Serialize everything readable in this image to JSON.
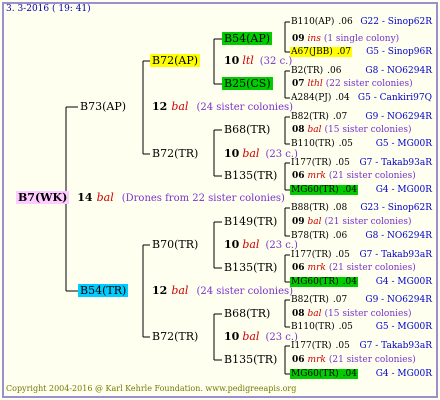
{
  "header": "3.  3-2016 ( 19: 41)",
  "footer": "Copyright 2004-2016 @ Karl Kehrle Foundation.   www.pedigreeapis.org",
  "root": {
    "name": "B7(WK)",
    "year": "14",
    "race": "bal",
    "note": "(Drones from 22 sister colonies)",
    "bg": "#ffccff"
  },
  "g1": [
    {
      "name": "B73(AP)",
      "year": "12",
      "race": "bal",
      "note": "(24 sister colonies)",
      "bg": ""
    },
    {
      "name": "B54(TR)",
      "year": "12",
      "race": "bal",
      "note": "(24 sister colonies)",
      "bg": "#00ccff"
    }
  ],
  "g2": [
    {
      "name": "B72(AP)",
      "year": "10",
      "race": "ltl",
      "note": "(32 c.)",
      "bg": "#ffff00"
    },
    {
      "name": "B72(TR)",
      "year": "10",
      "race": "bal",
      "note": "(23 c.)",
      "bg": ""
    },
    {
      "name": "B70(TR)",
      "year": "10",
      "race": "bal",
      "note": "(23 c.)",
      "bg": ""
    },
    {
      "name": "B72(TR)",
      "year": "10",
      "race": "bal",
      "note": "(23 c.)",
      "bg": ""
    }
  ],
  "g3": [
    {
      "name": "B54(AP)",
      "year": "09",
      "race": "ins",
      "note": "(1 single colony)",
      "bg": "#00cc00"
    },
    {
      "name": "B25(CS)",
      "year": "07",
      "race": "lthl",
      "note": "(22 sister colonies)",
      "bg": "#00cc00"
    },
    {
      "name": "B68(TR)",
      "year": "08",
      "race": "bal",
      "note": "(15 sister colonies)",
      "bg": ""
    },
    {
      "name": "B135(TR)",
      "year": "06",
      "race": "mrk",
      "note": "(21 sister colonies)",
      "bg": ""
    },
    {
      "name": "B149(TR)",
      "year": "09",
      "race": "bal",
      "note": "(21 sister colonies)",
      "bg": ""
    },
    {
      "name": "B135(TR)",
      "year": "06",
      "race": "mrk",
      "note": "(21 sister colonies)",
      "bg": ""
    },
    {
      "name": "B68(TR)",
      "year": "08",
      "race": "bal",
      "note": "(15 sister colonies)",
      "bg": ""
    },
    {
      "name": "B135(TR)",
      "year": "06",
      "race": "mrk",
      "note": "(21 sister colonies)",
      "bg": ""
    }
  ],
  "g4": [
    {
      "name": "B110(AP)",
      "val": ".06",
      "breeder": "G22 - Sinop62R",
      "bg": ""
    },
    {
      "name": "A67(JBB)",
      "val": ".07",
      "breeder": "G5 - Sinop96R",
      "bg": "#ffff00"
    },
    {
      "name": "B2(TR)",
      "val": ".06",
      "breeder": "G8 - NO6294R",
      "bg": ""
    },
    {
      "name": "A284(PJ)",
      "val": ".04",
      "breeder": "G5 - Cankiri97Q",
      "bg": ""
    },
    {
      "name": "B82(TR)",
      "val": ".07",
      "breeder": "G9 - NO6294R",
      "bg": ""
    },
    {
      "name": "B110(TR)",
      "val": ".05",
      "breeder": "G5 - MG00R",
      "bg": ""
    },
    {
      "name": "I177(TR)",
      "val": ".05",
      "breeder": "G7 - Takab93aR",
      "bg": ""
    },
    {
      "name": "MG60(TR)",
      "val": ".04",
      "breeder": "G4 - MG00R",
      "bg": "#00cc00"
    },
    {
      "name": "B88(TR)",
      "val": ".08",
      "breeder": "G23 - Sinop62R",
      "bg": ""
    },
    {
      "name": "B78(TR)",
      "val": ".06",
      "breeder": "G8 - NO6294R",
      "bg": ""
    },
    {
      "name": "I177(TR)",
      "val": ".05",
      "breeder": "G7 - Takab93aR",
      "bg": ""
    },
    {
      "name": "MG60(TR)",
      "val": ".04",
      "breeder": "G4 - MG00R",
      "bg": "#00cc00"
    },
    {
      "name": "B82(TR)",
      "val": ".07",
      "breeder": "G9 - NO6294R",
      "bg": ""
    },
    {
      "name": "B110(TR)",
      "val": ".05",
      "breeder": "G5 - MG00R",
      "bg": ""
    },
    {
      "name": "I177(TR)",
      "val": ".05",
      "breeder": "G7 - Takab93aR",
      "bg": ""
    },
    {
      "name": "MG60(TR)",
      "val": ".04",
      "breeder": "G4 - MG00R",
      "bg": "#00cc00"
    }
  ]
}
